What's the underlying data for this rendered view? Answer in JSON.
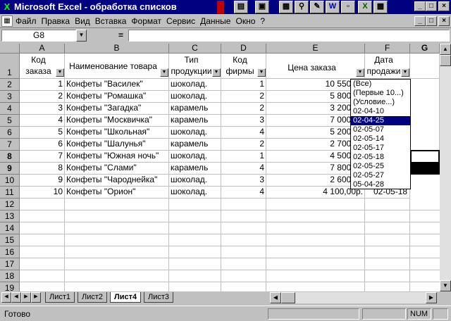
{
  "window": {
    "title": "Microsoft Excel - обработка списков",
    "app_icon": "X"
  },
  "toolbar_icons": [
    "chart-icon",
    "doc-icon",
    "excel-icon",
    "search-icon",
    "paint-icon",
    "word-icon",
    "folder-icon",
    "excel-x-icon",
    "screen-icon"
  ],
  "menu": {
    "items": [
      {
        "label": "Файл"
      },
      {
        "label": "Правка"
      },
      {
        "label": "Вид"
      },
      {
        "label": "Вставка"
      },
      {
        "label": "Формат"
      },
      {
        "label": "Сервис"
      },
      {
        "label": "Данные"
      },
      {
        "label": "Окно"
      },
      {
        "label": "?"
      }
    ]
  },
  "formula_bar": {
    "name_box": "G8",
    "eq": "=",
    "content": ""
  },
  "columns": [
    {
      "label": ""
    },
    {
      "label": "A"
    },
    {
      "label": "B"
    },
    {
      "label": "C"
    },
    {
      "label": "D"
    },
    {
      "label": "E"
    },
    {
      "label": "F"
    },
    {
      "label": "G"
    }
  ],
  "header_row": {
    "a": "Код заказа",
    "b": "Наименование товара",
    "c": "Тип продукции",
    "d": "Код фирмы",
    "e": "Цена заказа",
    "f": "Дата продажи"
  },
  "rows": [
    {
      "n": "2",
      "a": "1",
      "b": "Конфеты \"Василек\"",
      "c": "шоколад.",
      "d": "1",
      "e": "10 550,00"
    },
    {
      "n": "3",
      "a": "2",
      "b": "Конфеты \"Ромашка\"",
      "c": "шоколад.",
      "d": "2",
      "e": "5 800,00"
    },
    {
      "n": "4",
      "a": "3",
      "b": "Конфеты \"Загадка\"",
      "c": "карамель",
      "d": "2",
      "e": "3 200,00"
    },
    {
      "n": "5",
      "a": "4",
      "b": "Конфеты \"Москвичка\"",
      "c": "карамель",
      "d": "3",
      "e": "7 000,00"
    },
    {
      "n": "6",
      "a": "5",
      "b": "Конфеты \"Школьная\"",
      "c": "шоколад.",
      "d": "4",
      "e": "5 200,00"
    },
    {
      "n": "7",
      "a": "6",
      "b": "Конфеты \"Шалунья\"",
      "c": "карамель",
      "d": "2",
      "e": "2 700,00"
    },
    {
      "n": "8",
      "a": "7",
      "b": "Конфеты \"Южная ночь\"",
      "c": "шоколад.",
      "d": "1",
      "e": "4 500,00"
    },
    {
      "n": "9",
      "a": "8",
      "b": "Конфеты \"Слами\"",
      "c": "карамель",
      "d": "4",
      "e": "7 800,00"
    },
    {
      "n": "10",
      "a": "9",
      "b": "Конфеты \"Чароднейка\"",
      "c": "шоколад.",
      "d": "3",
      "e": "2 600,00"
    },
    {
      "n": "11",
      "a": "10",
      "b": "Конфеты \"Орион\"",
      "c": "шоколад.",
      "d": "4",
      "e": "4 100,00р.",
      "f": "02-05-18"
    }
  ],
  "empty_rows": [
    "12",
    "13",
    "14",
    "15",
    "16",
    "17",
    "18",
    "19"
  ],
  "row1_label": "1",
  "filter_dropdown": {
    "items": [
      "(Все)",
      "(Первые 10...)",
      "(Условие...)",
      "02-04-10",
      "02-04-25",
      "02-05-07",
      "02-05-14",
      "02-05-17",
      "02-05-18",
      "02-05-25",
      "02-05-27",
      "05-04-28"
    ],
    "selected_index": 4
  },
  "sheets": {
    "tabs": [
      "Лист1",
      "Лист2",
      "Лист4",
      "Лист3"
    ],
    "active": "Лист4"
  },
  "status": {
    "text": "Готово",
    "num": "NUM"
  }
}
